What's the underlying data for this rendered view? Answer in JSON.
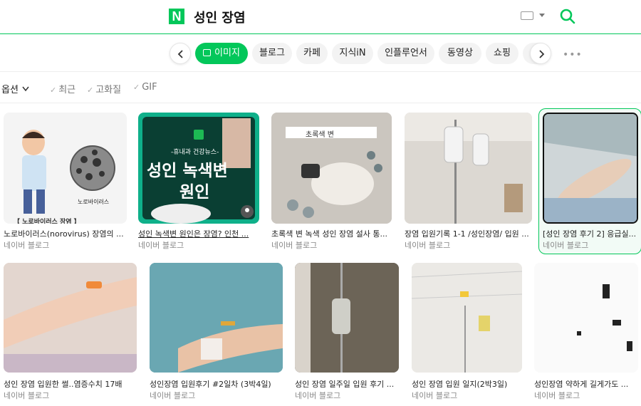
{
  "header": {
    "logo": "N",
    "query": "성인 장염"
  },
  "tabs": [
    {
      "label": "이미지",
      "active": true
    },
    {
      "label": "블로그"
    },
    {
      "label": "카페"
    },
    {
      "label": "지식iN"
    },
    {
      "label": "인플루언서"
    },
    {
      "label": "동영상"
    },
    {
      "label": "쇼핑"
    },
    {
      "label": "뉴"
    }
  ],
  "more_label": "•••",
  "filters": {
    "options_label": "옵션",
    "items": [
      "최근",
      "고화질",
      "GIF"
    ]
  },
  "results": [
    {
      "caption": "노로바이러스(norovirus) 장염의 ...",
      "source": "네이버 블로그",
      "overlay": "노로바이러스",
      "banner": "【 노로바이러스 장염 】"
    },
    {
      "caption": "성인 녹색변 원인은 장염? 인천 ...",
      "source": "네이버 블로그",
      "tag": "-휴내과 건강뉴스-",
      "headline1": "성인 녹색변",
      "headline2": "원인"
    },
    {
      "caption": "초록색 변 녹색 성인 장염 설사 통...",
      "source": "네이버 블로그",
      "overlay": "초록색 변"
    },
    {
      "caption": "장염 입원기록 1-1 /성인장염/ 입원 ...",
      "source": "네이버 블로그"
    },
    {
      "caption": "[성인 장염 후기 2] 응급실...",
      "source": "네이버 블로그"
    },
    {
      "caption": "성인 장염 입원한 썰..염증수치 17배",
      "source": "네이버 블로그"
    },
    {
      "caption": "성인장염 입원후기 #2일차 (3박4일)",
      "source": "네이버 블로그"
    },
    {
      "caption": "성인 장염 일주일 입원 후기 ...",
      "source": "네이버 블로그"
    },
    {
      "caption": "성인 장염 입원 일지(2박3일)",
      "source": "네이버 블로그"
    },
    {
      "caption": "성인장염 약하게 길게가도 ...",
      "source": "네이버 블로그"
    }
  ],
  "colors": {
    "brand": "#03c75a"
  }
}
